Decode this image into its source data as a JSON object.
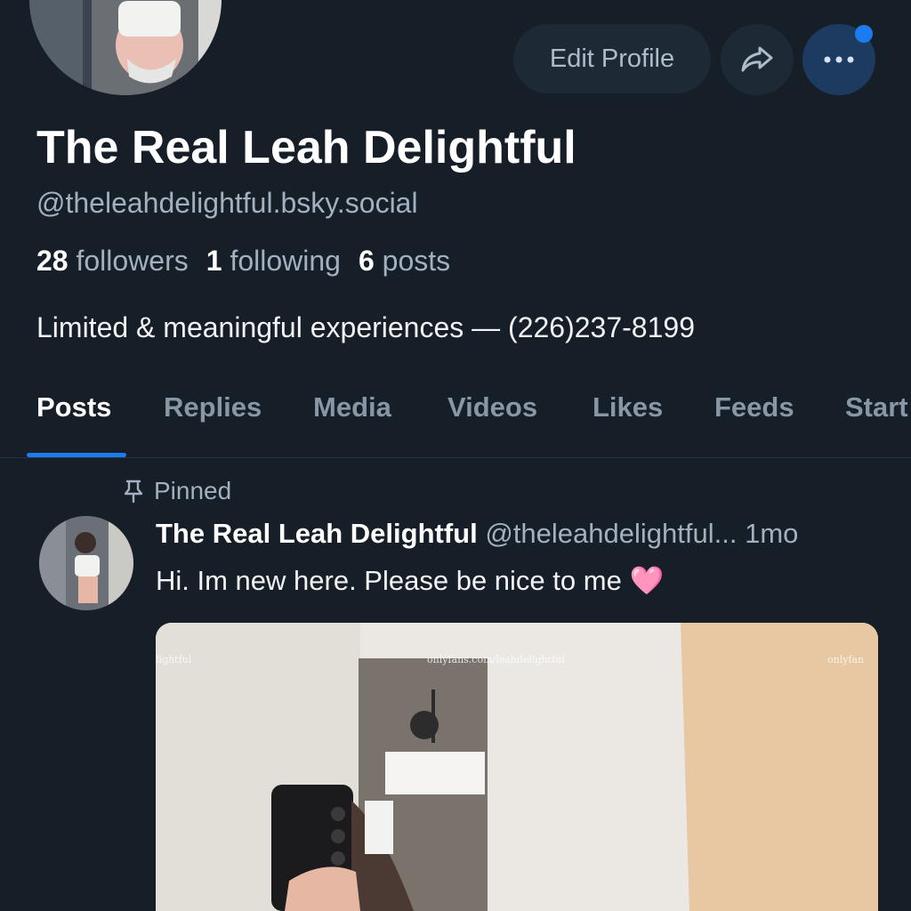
{
  "profile": {
    "display_name": "The Real Leah Delightful",
    "handle": "@theleahdelightful.bsky.social",
    "bio": "Limited & meaningful experiences — (226)237-8199"
  },
  "actions": {
    "edit_profile_label": "Edit Profile",
    "share_icon": "share-arrow-icon",
    "more_icon": "ellipsis-icon"
  },
  "stats": {
    "followers_count": "28",
    "followers_label": "followers",
    "following_count": "1",
    "following_label": "following",
    "posts_count": "6",
    "posts_label": "posts"
  },
  "tabs": [
    {
      "label": "Posts",
      "active": true
    },
    {
      "label": "Replies",
      "active": false
    },
    {
      "label": "Media",
      "active": false
    },
    {
      "label": "Videos",
      "active": false
    },
    {
      "label": "Likes",
      "active": false
    },
    {
      "label": "Feeds",
      "active": false
    },
    {
      "label": "Start",
      "active": false
    }
  ],
  "pinned_post": {
    "pinned_label": "Pinned",
    "author": "The Real Leah Delightful",
    "author_handle": "@theleahdelightful...",
    "time": "1mo",
    "text": "Hi. Im new here. Please be nice to me",
    "emoji": "🩷",
    "image_watermarks": [
      "lightful",
      "onlyfans.com/leahdelightful",
      "onlyfan"
    ]
  },
  "colors": {
    "background": "#161e27",
    "accent": "#1b7cf0",
    "muted_text": "#a3b0bf",
    "button_bg": "#1e2936"
  }
}
